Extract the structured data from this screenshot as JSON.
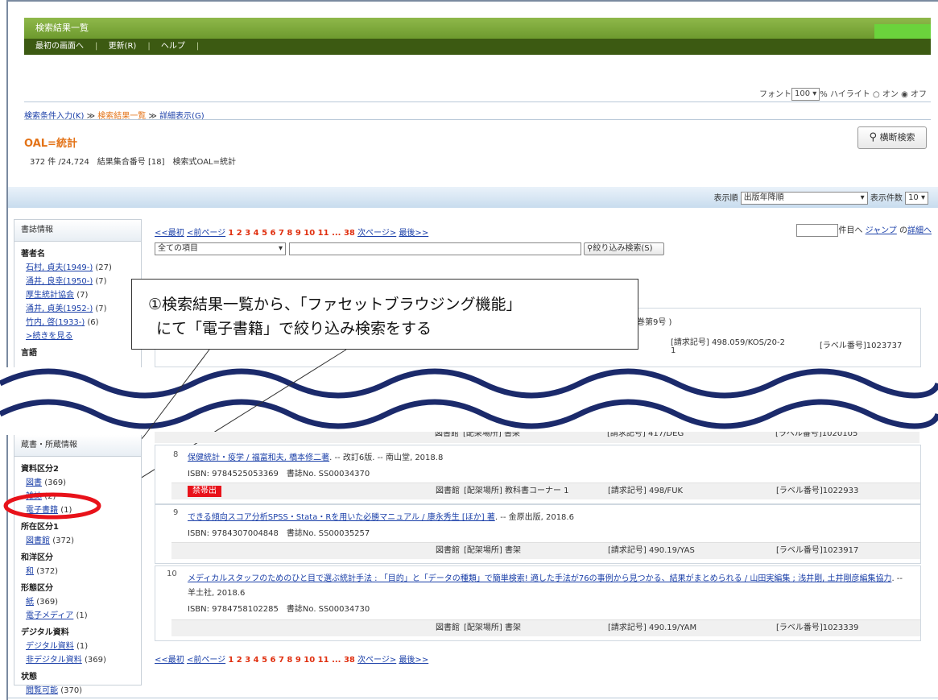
{
  "header": {
    "title": "検索結果一覧",
    "nav": [
      "最初の画面へ",
      "更新(R)",
      "ヘルプ"
    ]
  },
  "font_row": {
    "font_label": "フォント",
    "font_value": "100",
    "percent": "%",
    "highlight_label": "ハイライト",
    "on": "オン",
    "off": "オフ"
  },
  "breadcrumb": {
    "item1": "検索条件入力(K)",
    "sep": "≫",
    "item2": "検索結果一覧",
    "item3": "詳細表示(G)"
  },
  "query_title": "OAL=統計",
  "cross_search": "横断検索",
  "counts": "372 件 /24,724　結果集合番号 [18]　検索式OAL=統計",
  "sort": {
    "label": "表示順",
    "value": "出版年降順",
    "count_label": "表示件数",
    "count_value": "10"
  },
  "pager": {
    "first": "<<最初",
    "prev": "<前ページ",
    "pages": "1 2 3 4 5 6 7 8 9 10 11 ... 38",
    "next": "次ページ>",
    "last": "最後>>"
  },
  "jump": {
    "suffix": "件目へ",
    "jump": "ジャンプ",
    "detail_pre": "の",
    "detail": "詳細へ"
  },
  "filter": {
    "field": "全ての項目",
    "button": "絞り込み検索(S)"
  },
  "sidebar_top": {
    "head": "書誌情報",
    "author_section": "著者名",
    "authors": [
      {
        "name": "石村, 貞夫(1949-)",
        "count": "(27)"
      },
      {
        "name": "涌井, 良幸(1950-)",
        "count": "(7)"
      },
      {
        "name": "厚生統計協会",
        "count": "(7)"
      },
      {
        "name": "涌井, 貞美(1952-)",
        "count": "(7)"
      },
      {
        "name": "竹内, 啓(1933-)",
        "count": "(6)"
      }
    ],
    "more": ">続きを見る",
    "lang_section": "言語"
  },
  "sidebar_bottom": {
    "head": "蔵書・所蔵情報",
    "sections": [
      {
        "title": "資料区分2",
        "items": [
          {
            "name": "図書",
            "count": "(369)"
          },
          {
            "name": "雑誌",
            "count": "(2)"
          },
          {
            "name": "電子書籍",
            "count": "(1)"
          }
        ]
      },
      {
        "title": "所在区分1",
        "items": [
          {
            "name": "図書館",
            "count": "(372)"
          }
        ]
      },
      {
        "title": "和洋区分",
        "items": [
          {
            "name": "和",
            "count": "(372)"
          }
        ]
      },
      {
        "title": "形態区分",
        "items": [
          {
            "name": "紙",
            "count": "(369)"
          },
          {
            "name": "電子メディア",
            "count": "(1)"
          }
        ]
      },
      {
        "title": "デジタル資料",
        "items": [
          {
            "name": "デジタル資料",
            "count": "(1)"
          },
          {
            "name": "非デジタル資料",
            "count": "(369)"
          }
        ]
      },
      {
        "title": "状態",
        "items": [
          {
            "name": "閲覧可能",
            "count": "(370)"
          }
        ]
      }
    ]
  },
  "partial_results": {
    "tail_text": "巻第9号 )",
    "call_no": "[請求記号] 498.059/KOS/20-2",
    "call_no_line2": "1",
    "label_no": "[ラベル番号]1023737",
    "holding_7": {
      "library": "図書館",
      "place": "[配架場所] 書架",
      "call": "[請求記号] 417/DEG",
      "label": "[ラベル番号]1020105"
    }
  },
  "results": [
    {
      "num": "8",
      "title": "保健統計・疫学 / 福富和夫, 橋本修二著",
      "rest": ". -- 改訂6版. -- 南山堂, 2018.8",
      "isbn": "ISBN: 9784525053369　書誌No. SS00034370",
      "badge": "禁帯出",
      "library": "図書館",
      "place": "[配架場所] 教科書コーナー 1",
      "call": "[請求記号] 498/FUK",
      "label": "[ラベル番号]1022933"
    },
    {
      "num": "9",
      "title": "できる傾向スコア分析SPSS・Stata・Rを用いた必勝マニュアル / 康永秀生 [ほか] 著",
      "rest": ". -- 金原出版, 2018.6",
      "isbn": "ISBN: 9784307004848　書誌No. SS00035257",
      "library": "図書館",
      "place": "[配架場所] 書架",
      "call": "[請求記号] 490.19/YAS",
      "label": "[ラベル番号]1023917"
    },
    {
      "num": "10",
      "title": "メディカルスタッフのためのひと目で選ぶ統計手法 : 「目的」と「データの種類」で簡単検索! 適した手法が76の事例から見つかる、結果がまとめられる / 山田実編集 ; 浅井剛, 土井剛彦編集協力",
      "rest": ". --",
      "line2": "羊土社, 2018.6",
      "isbn": "ISBN: 9784758102285　書誌No. SS00034730",
      "library": "図書館",
      "place": "[配架場所] 書架",
      "call": "[請求記号] 490.19/YAM",
      "label": "[ラベル番号]1023339"
    }
  ],
  "callout": {
    "line1": "①検索結果一覧から、「ファセットブラウジング機能」",
    "line2": "にて「電子書籍」で絞り込み検索をする"
  },
  "colors": {
    "header_green": "#6d9a2e",
    "nav_dark": "#3c5a12",
    "accent_orange": "#e37318",
    "link_blue": "#1a3fa8",
    "highlight_red": "#e8121a",
    "wave_navy": "#1b2a6b"
  }
}
